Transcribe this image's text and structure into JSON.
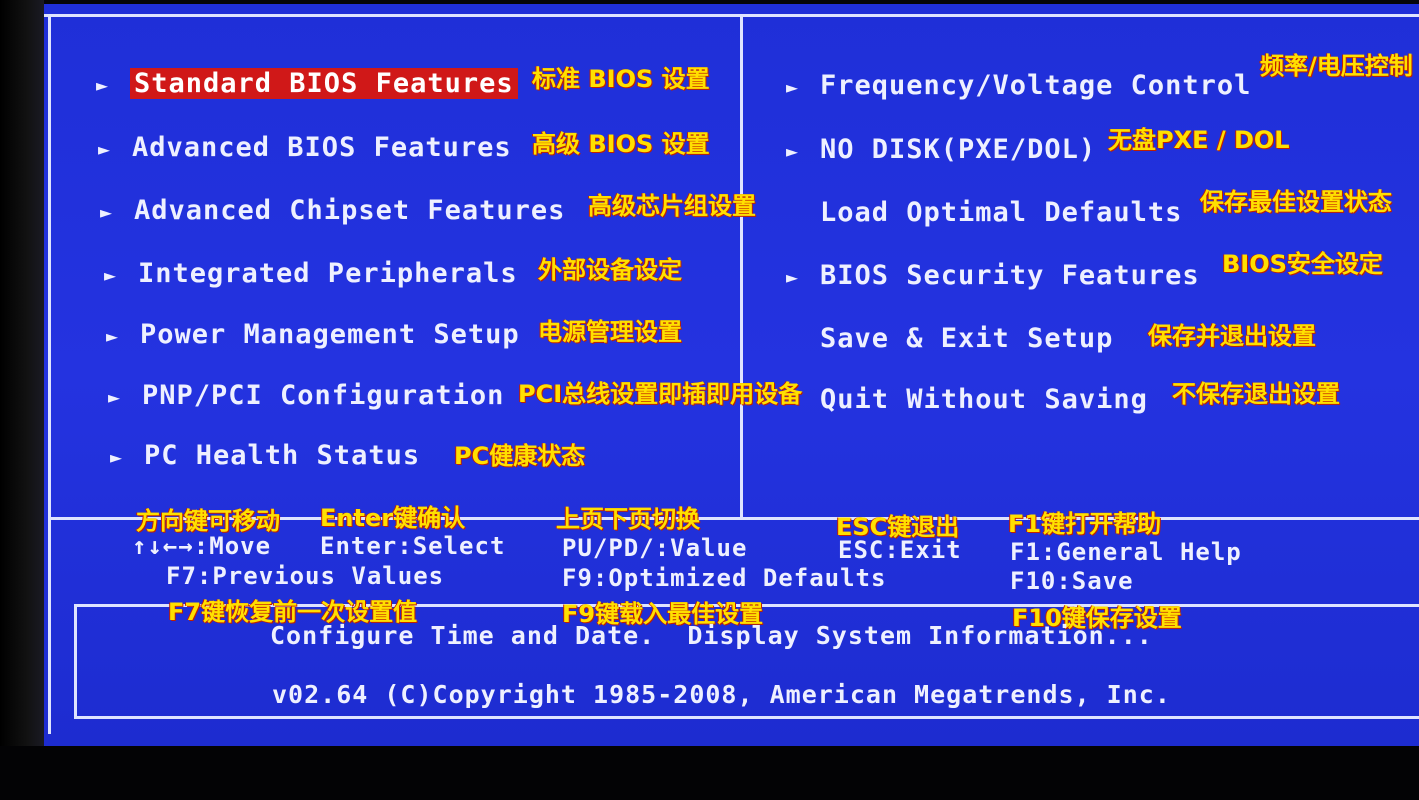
{
  "main_menu_left": [
    {
      "label": "Standard BIOS Features",
      "selected": true,
      "note": "标准 BIOS 设置"
    },
    {
      "label": "Advanced BIOS Features",
      "note": "高级 BIOS 设置"
    },
    {
      "label": "Advanced Chipset Features",
      "note": "高级芯片组设置"
    },
    {
      "label": "Integrated Peripherals",
      "note": "外部设备设定"
    },
    {
      "label": "Power Management Setup",
      "note": "电源管理设置"
    },
    {
      "label": "PNP/PCI Configuration",
      "note": "PCI总线设置即插即用设备"
    },
    {
      "label": "PC Health Status",
      "note": "PC健康状态"
    }
  ],
  "main_menu_right": [
    {
      "label": "Frequency/Voltage Control",
      "note": "频率/电压控制"
    },
    {
      "label": "NO DISK(PXE/DOL)",
      "note": "无盘PXE / DOL"
    },
    {
      "label": "Load Optimal Defaults",
      "note": "保存最佳设置状态"
    },
    {
      "label": "BIOS Security Features",
      "note": "BIOS安全设定"
    },
    {
      "label": "Save & Exit Setup",
      "note": "保存并退出设置"
    },
    {
      "label": "Quit Without Saving",
      "note": "不保存退出设置"
    }
  ],
  "arrow_glyph": "►",
  "key_help": {
    "move": "↑↓←→:Move",
    "enter": "Enter:Select",
    "value": "PU/PD/:Value",
    "esc": "ESC:Exit",
    "f1": "F1:General Help",
    "f7": "F7:Previous Values",
    "f9": "F9:Optimized Defaults",
    "f10": "F10:Save"
  },
  "key_notes": {
    "move": "方向键可移动",
    "enter": "Enter键确认",
    "value": "上页下页切换",
    "esc": "ESC键退出",
    "f1": "F1键打开帮助",
    "f7": "F7键恢复前一次设置值",
    "f9": "F9键载入最佳设置",
    "f10": "F10键保存设置"
  },
  "description": "Configure Time and Date.  Display System Information...",
  "copyright": "v02.64 (C)Copyright 1985-2008, American Megatrends, Inc.",
  "colors": {
    "screen": "#2433e0",
    "highlight": "#d01818",
    "annotation": "#ffe000"
  }
}
